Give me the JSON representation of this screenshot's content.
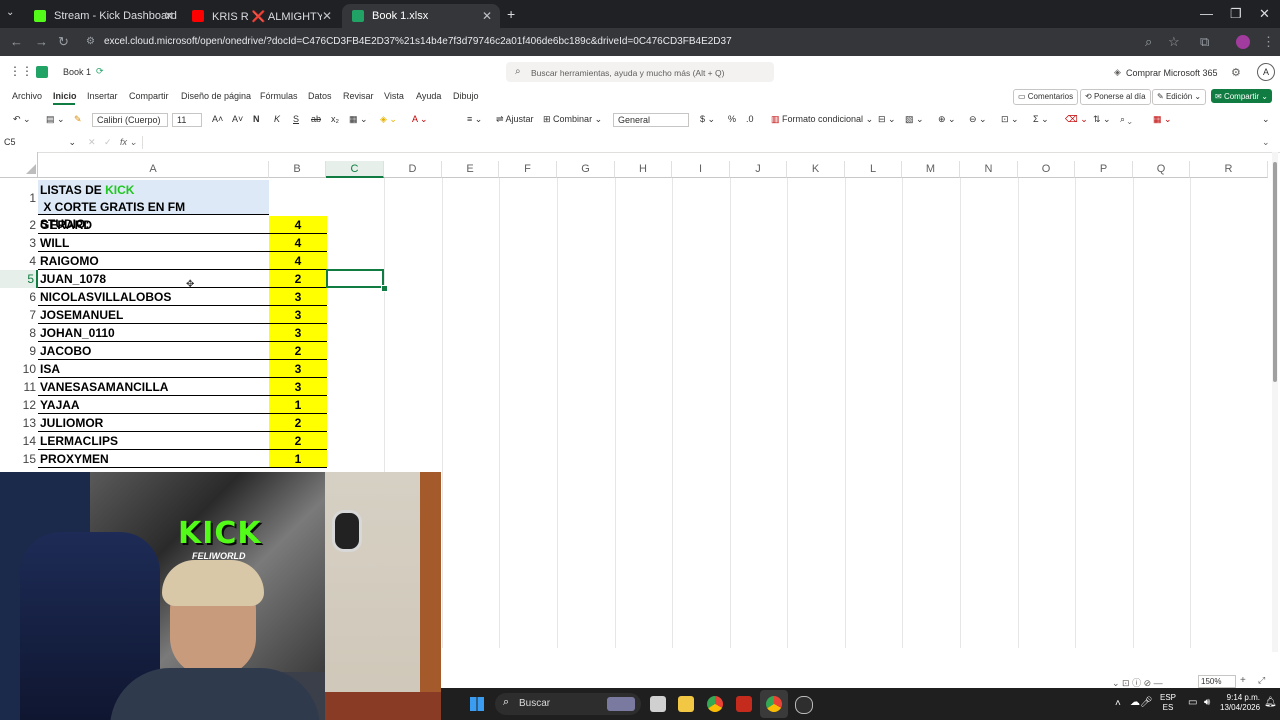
{
  "browser": {
    "tabs": [
      {
        "label": "Stream - Kick Dashboard",
        "color": "#53fc18"
      },
      {
        "label": "KRIS R ❌ ALMIGHTY ❌ HAD̈",
        "color": "#ff0000"
      },
      {
        "label": "Book 1.xlsx",
        "color": "#21a366"
      }
    ],
    "url": "excel.cloud.microsoft/open/onedrive/?docId=C476CD3FB4E2D37%21s14b4e7f3d79746c2a01f406de6bc189c&driveId=0C476CD3FB4E2D37"
  },
  "excel": {
    "doc_title": "Book 1",
    "search_placeholder": "Buscar herramientas, ayuda y mucho más (Alt + Q)",
    "buy_label": "Comprar Microsoft 365",
    "avatar": "A",
    "menu": [
      "Archivo",
      "Inicio",
      "Insertar",
      "Compartir",
      "Diseño de página",
      "Fórmulas",
      "Datos",
      "Revisar",
      "Vista",
      "Ayuda",
      "Dibujo"
    ],
    "comments_label": "Comentarios",
    "catchup_label": "Ponerse al día",
    "edit_label": "Edición",
    "share_label": "Compartir",
    "font_name": "Calibri (Cuerpo)",
    "font_size": "11",
    "wrap_label": "Ajustar",
    "merge_label": "Combinar",
    "number_format": "General",
    "cond_format_label": "Formato condicional",
    "name_box": "C5",
    "columns": [
      "A",
      "B",
      "C",
      "D",
      "E",
      "F",
      "G",
      "H",
      "I",
      "J",
      "K",
      "L",
      "M",
      "N",
      "O",
      "P",
      "Q",
      "R"
    ],
    "title_prefix": "LISTAS DE ",
    "title_kick": "KICK",
    "title_suffix": " X CORTE GRATIS EN FM",
    "title_line2": "STUDIO:",
    "rows": [
      {
        "n": "2",
        "name": "GERARD",
        "val": "4"
      },
      {
        "n": "3",
        "name": "WILL",
        "val": "4"
      },
      {
        "n": "4",
        "name": "RAIGOMO",
        "val": "4"
      },
      {
        "n": "5",
        "name": "JUAN_1078",
        "val": "2"
      },
      {
        "n": "6",
        "name": "NICOLASVILLALOBOS",
        "val": "3"
      },
      {
        "n": "7",
        "name": "JOSEMANUEL",
        "val": "3"
      },
      {
        "n": "8",
        "name": "JOHAN_0110",
        "val": "3"
      },
      {
        "n": "9",
        "name": "JACOBO",
        "val": "2"
      },
      {
        "n": "10",
        "name": "ISA",
        "val": "3"
      },
      {
        "n": "11",
        "name": "VANESASAMANCILLA",
        "val": "3"
      },
      {
        "n": "12",
        "name": "YAJAA",
        "val": "1"
      },
      {
        "n": "13",
        "name": "JULIOMOR",
        "val": "2"
      },
      {
        "n": "14",
        "name": "LERMACLIPS",
        "val": "2"
      },
      {
        "n": "15",
        "name": "PROXYMEN",
        "val": "1"
      }
    ],
    "zoom": "150%"
  },
  "webcam": {
    "logo_text": "KICK",
    "logo_sub": "FELIWORLD"
  },
  "taskbar": {
    "search_label": "Buscar",
    "lang": "ESP",
    "lang2": "ES",
    "time": "9:14 p.m.",
    "date": "13/04/2026"
  }
}
